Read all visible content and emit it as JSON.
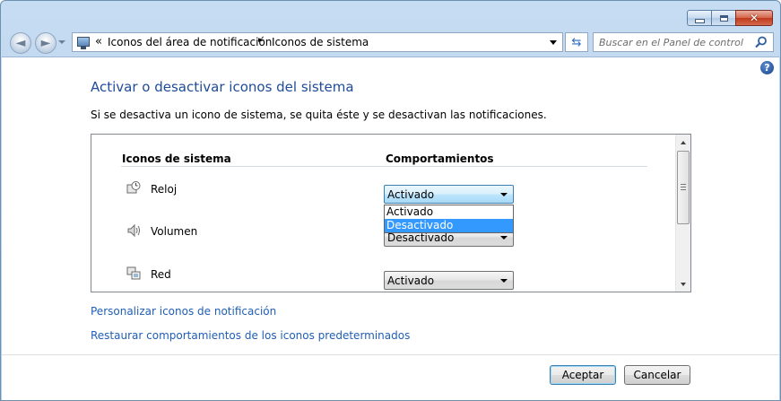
{
  "window": {
    "controls": {
      "minimize_icon": "minimize-icon",
      "maximize_icon": "maximize-icon",
      "close_icon": "close-icon"
    }
  },
  "navigation": {
    "back_icon": "back-arrow-icon",
    "forward_icon": "forward-arrow-icon",
    "address": {
      "chevron": "«",
      "breadcrumbs": [
        "Iconos del área de notificación",
        "Iconos de sistema"
      ],
      "separator": "►"
    },
    "refresh_icon": "refresh-icon",
    "search": {
      "placeholder": "Buscar en el Panel de control",
      "value": ""
    }
  },
  "content": {
    "help_label": "?",
    "title": "Activar o desactivar iconos del sistema",
    "description": "Si se desactiva un icono de sistema, se quita éste y se desactivan las notificaciones.",
    "table": {
      "headers": [
        "Iconos de sistema",
        "Comportamientos"
      ],
      "rows": [
        {
          "icon": "clock-icon",
          "label": "Reloj",
          "behavior": "Activado"
        },
        {
          "icon": "speaker-icon",
          "label": "Volumen",
          "behavior": "Desactivado"
        },
        {
          "icon": "network-icon",
          "label": "Red",
          "behavior": "Activado"
        }
      ],
      "dropdown_options": [
        "Activado",
        "Desactivado"
      ],
      "dropdown_highlighted": "Desactivado"
    },
    "links": [
      "Personalizar iconos de notificación",
      "Restaurar comportamientos de los iconos predeterminados"
    ],
    "buttons": {
      "ok": "Aceptar",
      "cancel": "Cancelar"
    }
  },
  "colors": {
    "title_blue": "#1e4b9a",
    "link_blue": "#1f5eb5",
    "selection": "#3399ff"
  }
}
